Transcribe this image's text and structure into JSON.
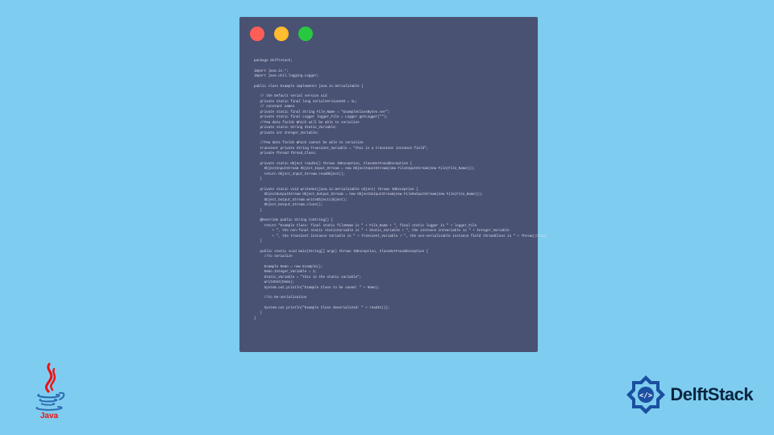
{
  "window": {
    "traffic_lights": [
      "red",
      "yellow",
      "green"
    ]
  },
  "code": {
    "lines": [
      "package delftstack;",
      "",
      "import java.io.*;",
      "import java.util.logging.Logger;",
      "",
      "public class Example implements java.io.Serializable {",
      "",
      "   // the Default serial version uid",
      "   private static final long serialVersionUID = 1L;",
      "   // constant names",
      "   private static final String File_Name = \"ExampleClassBytes.ser\";",
      "   private static final Logger logger_File = Logger.getLogger(\"\");",
      "   //Few data fields Which will be able to serialize",
      "   private static String Static_Variable;",
      "   private int Integer_Variable;",
      "",
      "   //Few data fields Which cannot be able to serialize",
      "   transient private String Transient_Variable = \"this is a transient instance field\";",
      "   private Thread Thread_Class;",
      "",
      "   private static Object readIn() throws IOException, ClassNotFoundException {",
      "     ObjectInputStream Object_Input_Stream = new ObjectInputStream(new FileInputStream(new File(File_Name)));",
      "     return Object_Input_Stream.readObject();",
      "   }",
      "",
      "   private static void writeOut(java.io.Serializable object) throws IOException {",
      "     ObjectOutputStream Object_Output_Stream = new ObjectOutputStream(new FileOutputStream(new File(File_Name)));",
      "     Object_Output_Stream.writeObject(object);",
      "     Object_Output_Stream.close();",
      "   }",
      "",
      "   @Override public String toString() {",
      "     return \"Example Class: final static fileName is \" + File_Name + \", final static logger is \" + logger_File",
      "         + \", the non-final static staticVariable is \" + Static_Variable + \", the instance intVariable is \" + Integer_Variable",
      "         + \", the transient instance Variable is \" + Transient_Variable + \", the non-serializable instance field threadClass is \" + Thread_Class;",
      "   }",
      "",
      "   public static void main(String[] args) throws IOException, ClassNotFoundException {",
      "     //to serialize",
      "",
      "     Example Demo = new Example();",
      "     Demo.Integer_Variable = 1;",
      "     Static_Variable = \"this is the static variable\";",
      "     writeOut(Demo);",
      "     System.out.println(\"Example Class to be saved: \" + Demo);",
      "",
      "     //to De-serialisation",
      "",
      "     System.out.println(\"Example Class deserialized: \" + readIn());",
      "   }",
      "}"
    ]
  },
  "java_logo": {
    "alt": "Java",
    "label": "Java"
  },
  "delft_logo": {
    "text": "DelftStack"
  }
}
